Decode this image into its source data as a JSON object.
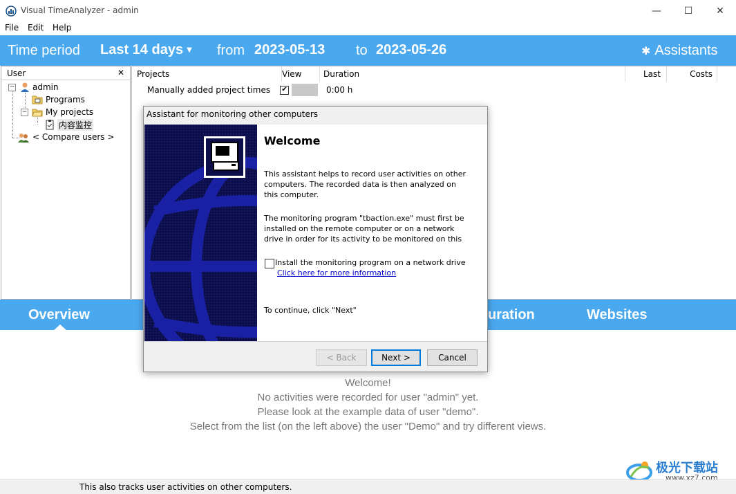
{
  "window": {
    "title": "Visual TimeAnalyzer - admin",
    "minimize": "—",
    "maximize": "☐",
    "close": "✕"
  },
  "menu": [
    "File",
    "Edit",
    "Help"
  ],
  "period": {
    "time_period_label": "Time period",
    "range_value": "Last 14 days",
    "from_label": "from",
    "from_date": "2023-05-13",
    "to_label": "to",
    "to_date": "2023-05-26",
    "assistants_label": "Assistants"
  },
  "user_panel": {
    "header": "User",
    "close": "✕",
    "tree": {
      "admin": "admin",
      "programs": "Programs",
      "my_projects": "My projects",
      "project": "内容监控",
      "compare": "< Compare users >"
    }
  },
  "projects_table": {
    "columns": [
      "Projects",
      "View",
      "Duration",
      "Last",
      "Costs"
    ],
    "rows": [
      {
        "name": "Manually added project times",
        "view_checked": true,
        "duration": "0:00 h"
      }
    ]
  },
  "tabs": [
    "Overview",
    "uration",
    "Websites"
  ],
  "messages": [
    "Welcome!",
    "No activities were recorded for user \"admin\" yet.",
    "Please look at the example data of user \"demo\".",
    "Select from the list (on the left above) the user \"Demo\" and try different views."
  ],
  "status_text": "This also tracks user activities on other computers.",
  "dialog": {
    "title": "Assistant for monitoring other computers",
    "heading": "Welcome",
    "para1": "This assistant helps to record user activities on other computers. The recorded data is then analyzed on this computer.",
    "para2": "The monitoring program \"tbaction.exe\" must first be installed on the remote computer or on a network drive in order for its activity to be monitored on this",
    "checkbox_label": "Install the monitoring program on a network drive",
    "checkbox_checked": false,
    "link": "Click here for more information",
    "continue_text": "To continue, click \"Next\"",
    "back_button": "< Back",
    "next_button": "Next >",
    "cancel_button": "Cancel"
  },
  "watermark": {
    "text_cn": "极光下载站",
    "url": "www.xz7.com"
  },
  "colors": {
    "accent_blue": "#4aa8ef",
    "dialog_art_bg": "#0b0e4a",
    "link": "#0000cc"
  }
}
